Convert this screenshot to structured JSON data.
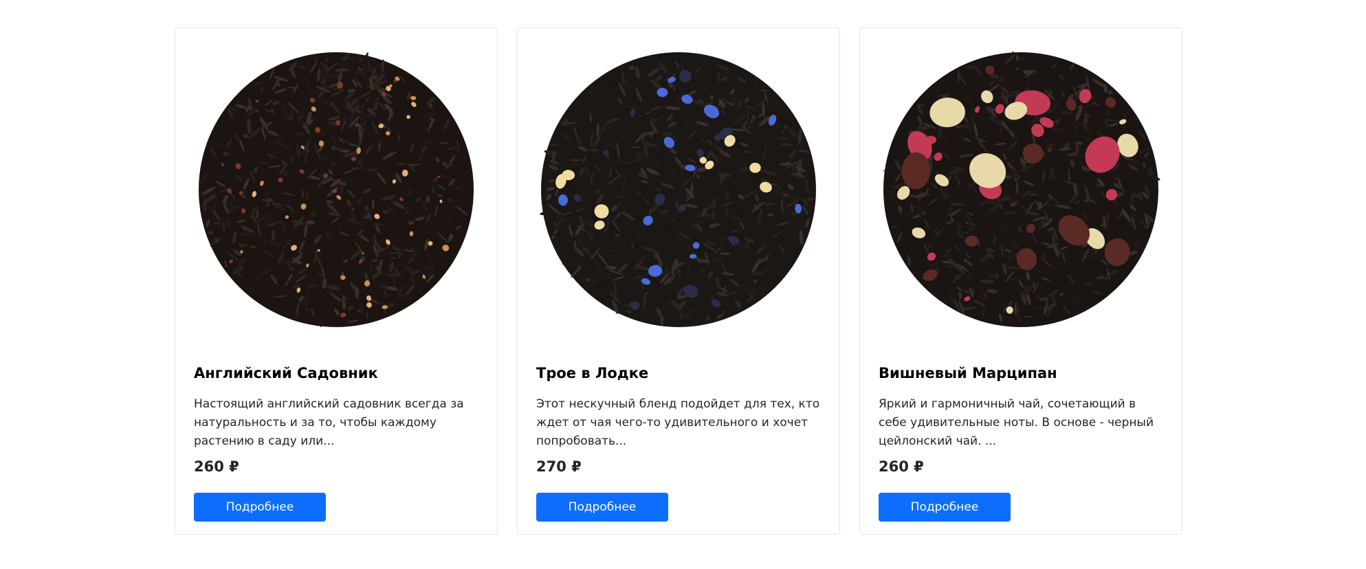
{
  "products": [
    {
      "title": "Английский Садовник",
      "description": "Настоящий английский садовник всегда за натуральность и за то, чтобы каждому растению в саду или...",
      "price": "260 ₽",
      "button_label": "Подробнее",
      "image_icon": "loose-black-tea-with-berries-image",
      "colors": {
        "leaf": "#1b1410",
        "accents": [
          "#c8905a",
          "#7a3a2a",
          "#e0b27a"
        ]
      }
    },
    {
      "title": "Трое в Лодке",
      "description": "Этот нескучный бленд подойдет для тех, кто ждет от чая чего-то удивительного и хочет попробовать...",
      "price": "270 ₽",
      "button_label": "Подробнее",
      "image_icon": "loose-black-tea-with-cornflower-image",
      "colors": {
        "leaf": "#1a1715",
        "accents": [
          "#4a6ad8",
          "#f0dca0",
          "#2a2c4a"
        ]
      }
    },
    {
      "title": "Вишневый Марципан",
      "description": "Яркий и гармоничный чай, сочетающий в себе удивительные ноты. В основе - черный цейлонский чай. ...",
      "price": "260 ₽",
      "button_label": "Подробнее",
      "image_icon": "loose-black-tea-with-cherry-almond-image",
      "colors": {
        "leaf": "#1a1412",
        "accents": [
          "#c43a55",
          "#e8d9a8",
          "#5a2a24"
        ]
      }
    }
  ],
  "theme": {
    "button_color": "#0d6efd",
    "border_color": "#e3e5e8"
  }
}
